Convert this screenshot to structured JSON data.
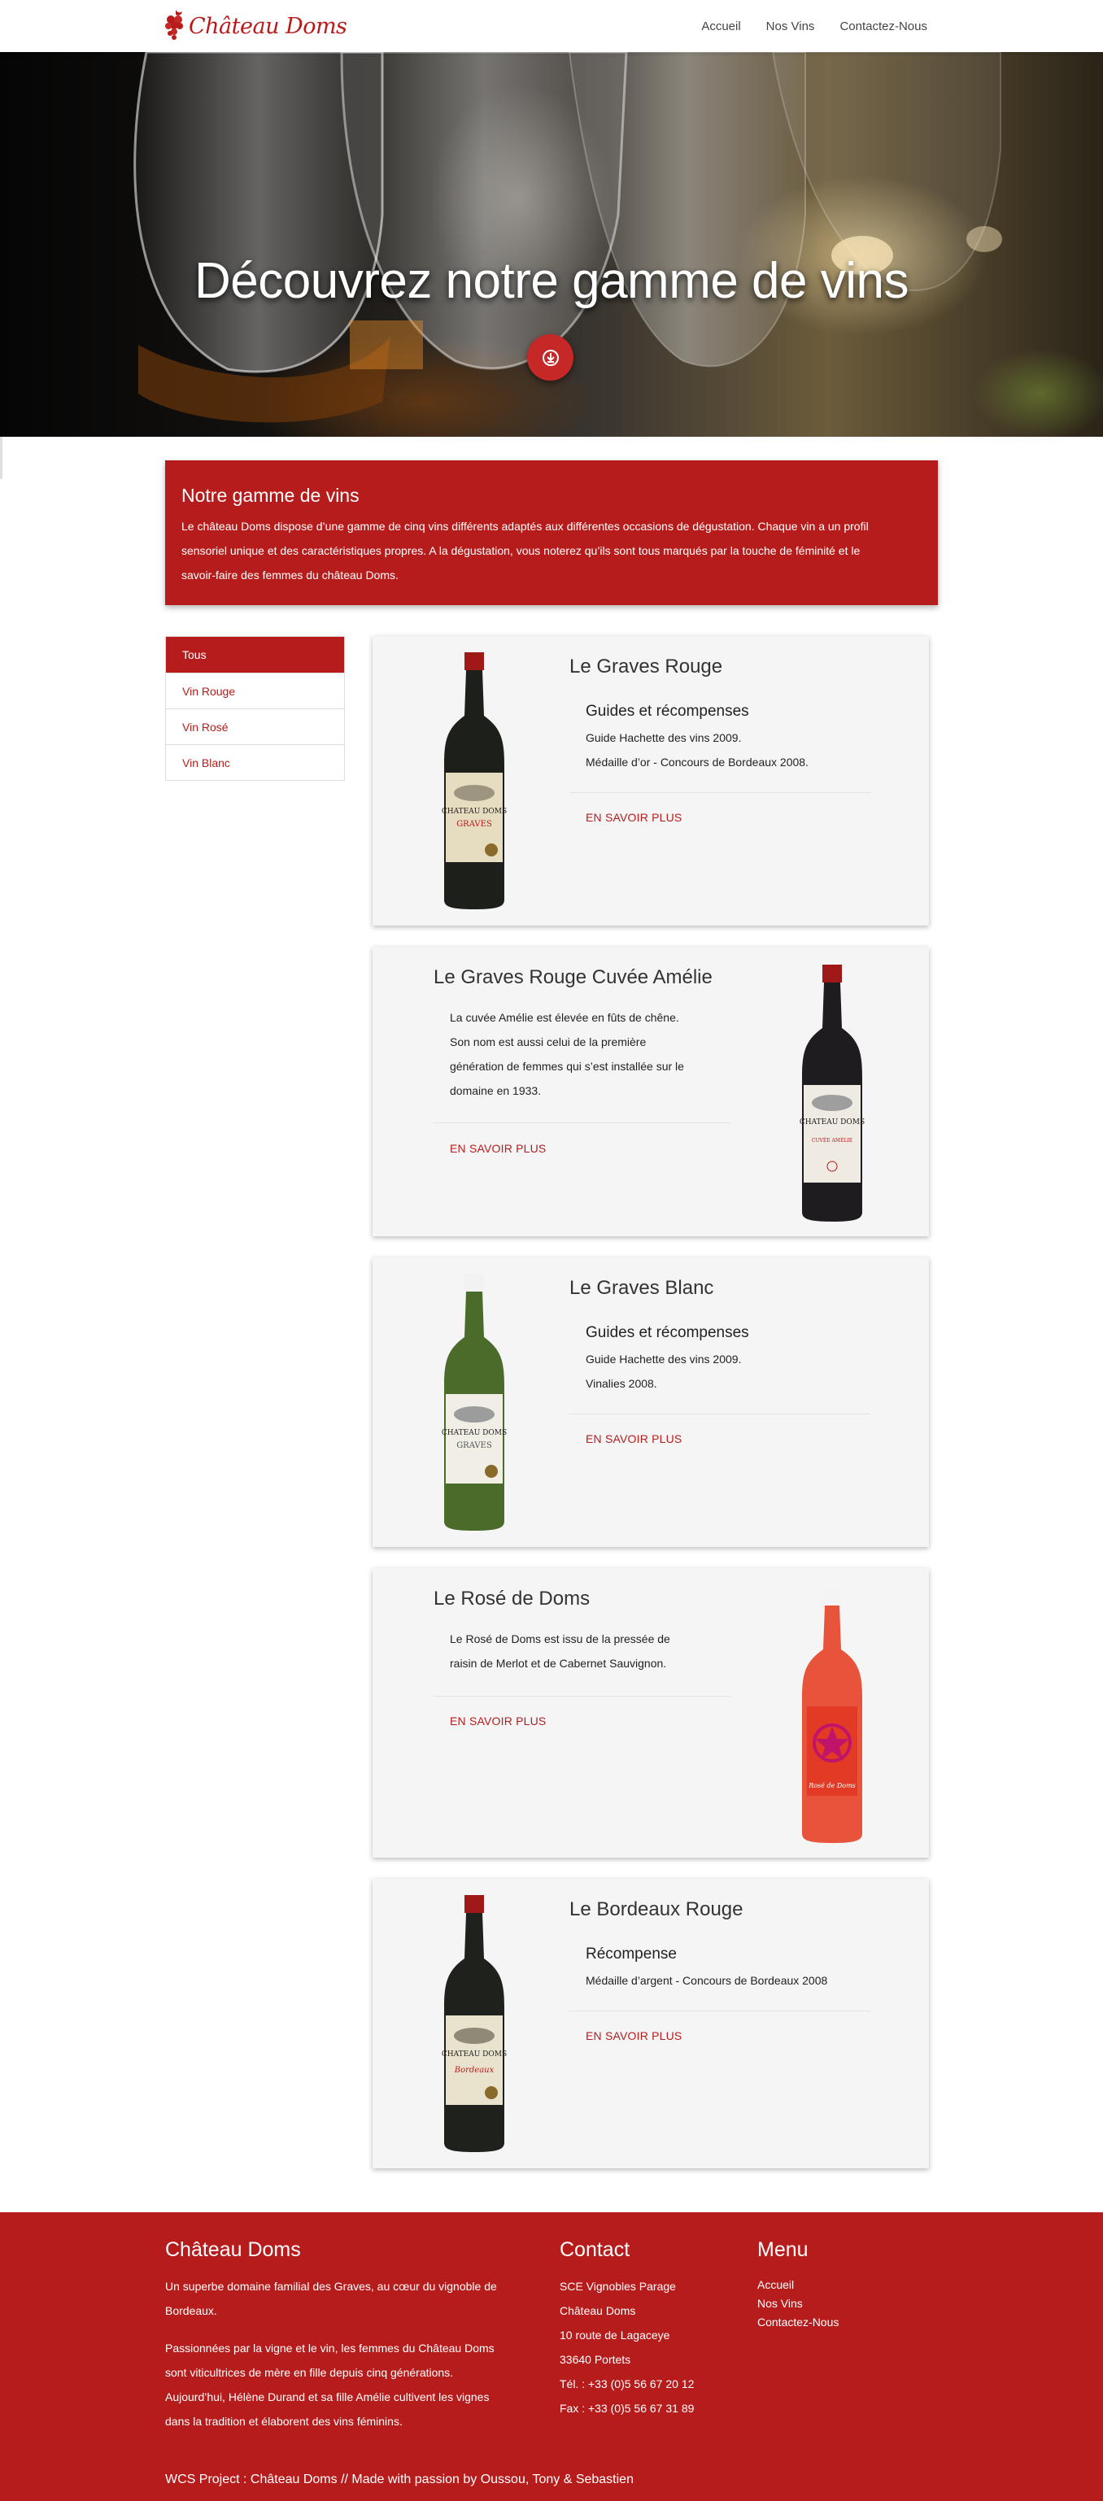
{
  "brand": {
    "name": "Château Doms",
    "color": "#b71c1c"
  },
  "nav": [
    {
      "label": "Accueil"
    },
    {
      "label": "Nos Vins"
    },
    {
      "label": "Contactez-Nous"
    }
  ],
  "hero": {
    "title": "Découvrez notre gamme de vins",
    "button_icon": "download-icon"
  },
  "intro": {
    "title": "Notre gamme de vins",
    "lines": [
      "Le château Doms dispose d’une gamme de cinq vins différents adaptés aux différentes occasions de dégustation. Chaque vin a un profil",
      "sensoriel unique et des caractéristiques propres. A la dégustation, vous noterez qu’ils sont tous marqués par la touche de féminité et le",
      "savoir-faire des femmes du château Doms."
    ]
  },
  "filters": [
    {
      "label": "Tous",
      "active": true
    },
    {
      "label": "Vin Rouge",
      "active": false
    },
    {
      "label": "Vin Rosé",
      "active": false
    },
    {
      "label": "Vin Blanc",
      "active": false
    }
  ],
  "wines": [
    {
      "name": "Le Graves Rouge",
      "subtitle": "Guides et récompenses",
      "lines": [
        "Guide Hachette des vins 2009.",
        "Médaille d’or - Concours de Bordeaux 2008."
      ],
      "more": "EN SAVOIR PLUS",
      "bottle": "red",
      "label_text": "CHATEAU DOMS",
      "label_sub": "GRAVES"
    },
    {
      "name": "Le Graves Rouge Cuvée Amélie",
      "subtitle": "",
      "lines": [
        "La cuvée Amélie est élevée en fûts de chêne.",
        "Son nom est aussi celui de la première",
        "génération de femmes qui s’est installée sur le",
        "domaine en 1933."
      ],
      "more": "EN SAVOIR PLUS",
      "bottle": "red",
      "label_text": "CHATEAU DOMS",
      "label_sub": "CUVÉE AMÉLIE"
    },
    {
      "name": "Le Graves Blanc",
      "subtitle": "Guides et récompenses",
      "lines": [
        "Guide Hachette des vins 2009.",
        "Vinalies 2008."
      ],
      "more": "EN SAVOIR PLUS",
      "bottle": "white",
      "label_text": "CHATEAU DOMS",
      "label_sub": "GRAVES"
    },
    {
      "name": "Le Rosé de Doms",
      "subtitle": "",
      "lines": [
        "Le Rosé de Doms est issu de la pressée de",
        "raisin de Merlot et de Cabernet Sauvignon."
      ],
      "more": "EN SAVOIR PLUS",
      "bottle": "rose",
      "label_text": "Rosé de Doms",
      "label_sub": ""
    },
    {
      "name": "Le Bordeaux Rouge",
      "subtitle": "Récompense",
      "lines": [
        "Médaille d’argent - Concours de Bordeaux 2008"
      ],
      "more": "EN SAVOIR PLUS",
      "bottle": "red",
      "label_text": "CHATEAU DOMS",
      "label_sub": "Bordeaux"
    }
  ],
  "footer": {
    "about_title": "Château Doms",
    "about_lines": [
      "Un superbe domaine familial des Graves, au cœur du vignoble de",
      "Bordeaux.",
      "Passionnées par la vigne et le vin, les femmes du Château Doms",
      "sont viticultrices de mère en fille depuis cinq générations.",
      "Aujourd’hui, Hélène Durand et sa fille Amélie cultivent les vignes",
      "dans la tradition et élaborent des vins féminins."
    ],
    "contact_title": "Contact",
    "contact_lines": [
      "SCE Vignobles Parage",
      "Château Doms",
      "10 route de Lagaceye",
      "33640 Portets",
      "Tél. : +33 (0)5 56 67 20 12",
      "Fax : +33 (0)5 56 67 31 89"
    ],
    "menu_title": "Menu",
    "menu": [
      {
        "label": "Accueil"
      },
      {
        "label": "Nos Vins"
      },
      {
        "label": "Contactez-Nous"
      }
    ],
    "credit": "WCS Project : Château Doms // Made with passion by Oussou, Tony & Sebastien"
  }
}
